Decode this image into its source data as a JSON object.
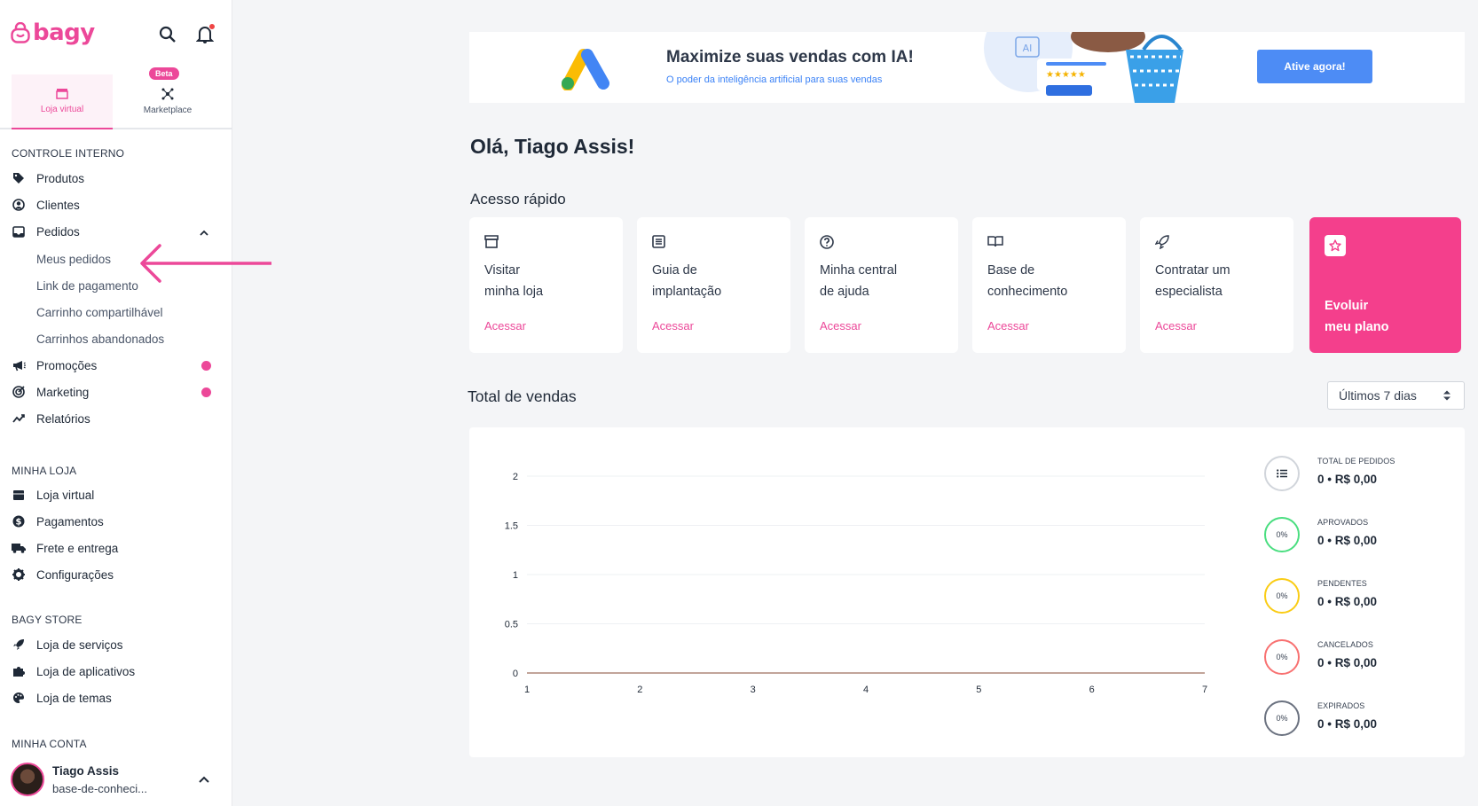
{
  "brand": {
    "name": "bagy",
    "color": "#ec4899"
  },
  "header_icons": {
    "search": "search-icon",
    "bell": "bell-icon"
  },
  "store_tabs": [
    {
      "label": "Loja virtual",
      "icon": "store-icon",
      "active": true
    },
    {
      "label": "Marketplace",
      "icon": "network-icon",
      "badge": "Beta"
    }
  ],
  "sidebar": {
    "sections": [
      {
        "title": "CONTROLE INTERNO"
      },
      {
        "title": "MINHA LOJA"
      },
      {
        "title": "BAGY STORE"
      },
      {
        "title": "MINHA CONTA"
      }
    ],
    "controle": [
      {
        "label": "Produtos",
        "icon": "tag-icon"
      },
      {
        "label": "Clientes",
        "icon": "user-circle-icon"
      },
      {
        "label": "Pedidos",
        "icon": "inbox-icon",
        "expanded": true
      },
      {
        "label": "Promoções",
        "icon": "megaphone-icon",
        "dot": true
      },
      {
        "label": "Marketing",
        "icon": "target-icon",
        "dot": true
      },
      {
        "label": "Relatórios",
        "icon": "trend-icon"
      }
    ],
    "pedidos_sub": [
      {
        "label": "Meus pedidos"
      },
      {
        "label": "Link de pagamento"
      },
      {
        "label": "Carrinho compartilhável"
      },
      {
        "label": "Carrinhos abandonados"
      }
    ],
    "minha_loja": [
      {
        "label": "Loja virtual",
        "icon": "store-icon"
      },
      {
        "label": "Pagamentos",
        "icon": "dollar-icon"
      },
      {
        "label": "Frete e entrega",
        "icon": "truck-icon"
      },
      {
        "label": "Configurações",
        "icon": "gear-icon"
      }
    ],
    "bagy_store": [
      {
        "label": "Loja de serviços",
        "icon": "rocket-icon"
      },
      {
        "label": "Loja de aplicativos",
        "icon": "puzzle-icon"
      },
      {
        "label": "Loja de temas",
        "icon": "palette-icon"
      }
    ],
    "account": {
      "name": "Tiago Assis",
      "store": "base-de-conheci..."
    }
  },
  "banner": {
    "title": "Maximize suas vendas com IA!",
    "subtitle": "O poder da inteligência artificial para suas vendas",
    "button": "Ative agora!",
    "art_label": "AI",
    "stars": "★★★★★"
  },
  "greeting": "Olá, Tiago Assis!",
  "quick_access": {
    "title": "Acesso rápido",
    "cards": [
      {
        "line1": "Visitar",
        "line2": "minha loja",
        "link": "Acessar",
        "icon": "store-icon"
      },
      {
        "line1": "Guia de",
        "line2": "implantação",
        "link": "Acessar",
        "icon": "list-icon"
      },
      {
        "line1": "Minha central",
        "line2": "de ajuda",
        "link": "Acessar",
        "icon": "question-icon"
      },
      {
        "line1": "Base de",
        "line2": "conhecimento",
        "link": "Acessar",
        "icon": "book-icon"
      },
      {
        "line1": "Contratar um",
        "line2": "especialista",
        "link": "Acessar",
        "icon": "rocket-icon"
      },
      {
        "line1": "Evoluir",
        "line2": "meu plano",
        "icon": "star-icon",
        "highlight": "#f43f8c"
      }
    ]
  },
  "sales": {
    "title": "Total de vendas",
    "period": "Últimos 7 dias"
  },
  "chart_data": {
    "type": "line",
    "x": [
      1,
      2,
      3,
      4,
      5,
      6,
      7
    ],
    "series": [
      {
        "values": [
          0,
          0,
          0,
          0,
          0,
          0,
          0
        ],
        "color": "#c2a59a"
      }
    ],
    "yticks": [
      "0",
      "0.5",
      "1",
      "1.5",
      "2"
    ],
    "ylim": [
      0,
      2
    ],
    "xlim": [
      1,
      7
    ],
    "grid": true
  },
  "stats": [
    {
      "label": "TOTAL DE PEDIDOS",
      "value": "0 • R$ 0,00",
      "ring": "",
      "color": "#d1d5db",
      "icon": "list-icon"
    },
    {
      "label": "APROVADOS",
      "value": "0 • R$ 0,00",
      "ring": "0%",
      "color": "#4ade80"
    },
    {
      "label": "PENDENTES",
      "value": "0 • R$ 0,00",
      "ring": "0%",
      "color": "#facc15"
    },
    {
      "label": "CANCELADOS",
      "value": "0 • R$ 0,00",
      "ring": "0%",
      "color": "#f87171"
    },
    {
      "label": "EXPIRADOS",
      "value": "0 • R$ 0,00",
      "ring": "0%",
      "color": "#6b7280"
    }
  ]
}
